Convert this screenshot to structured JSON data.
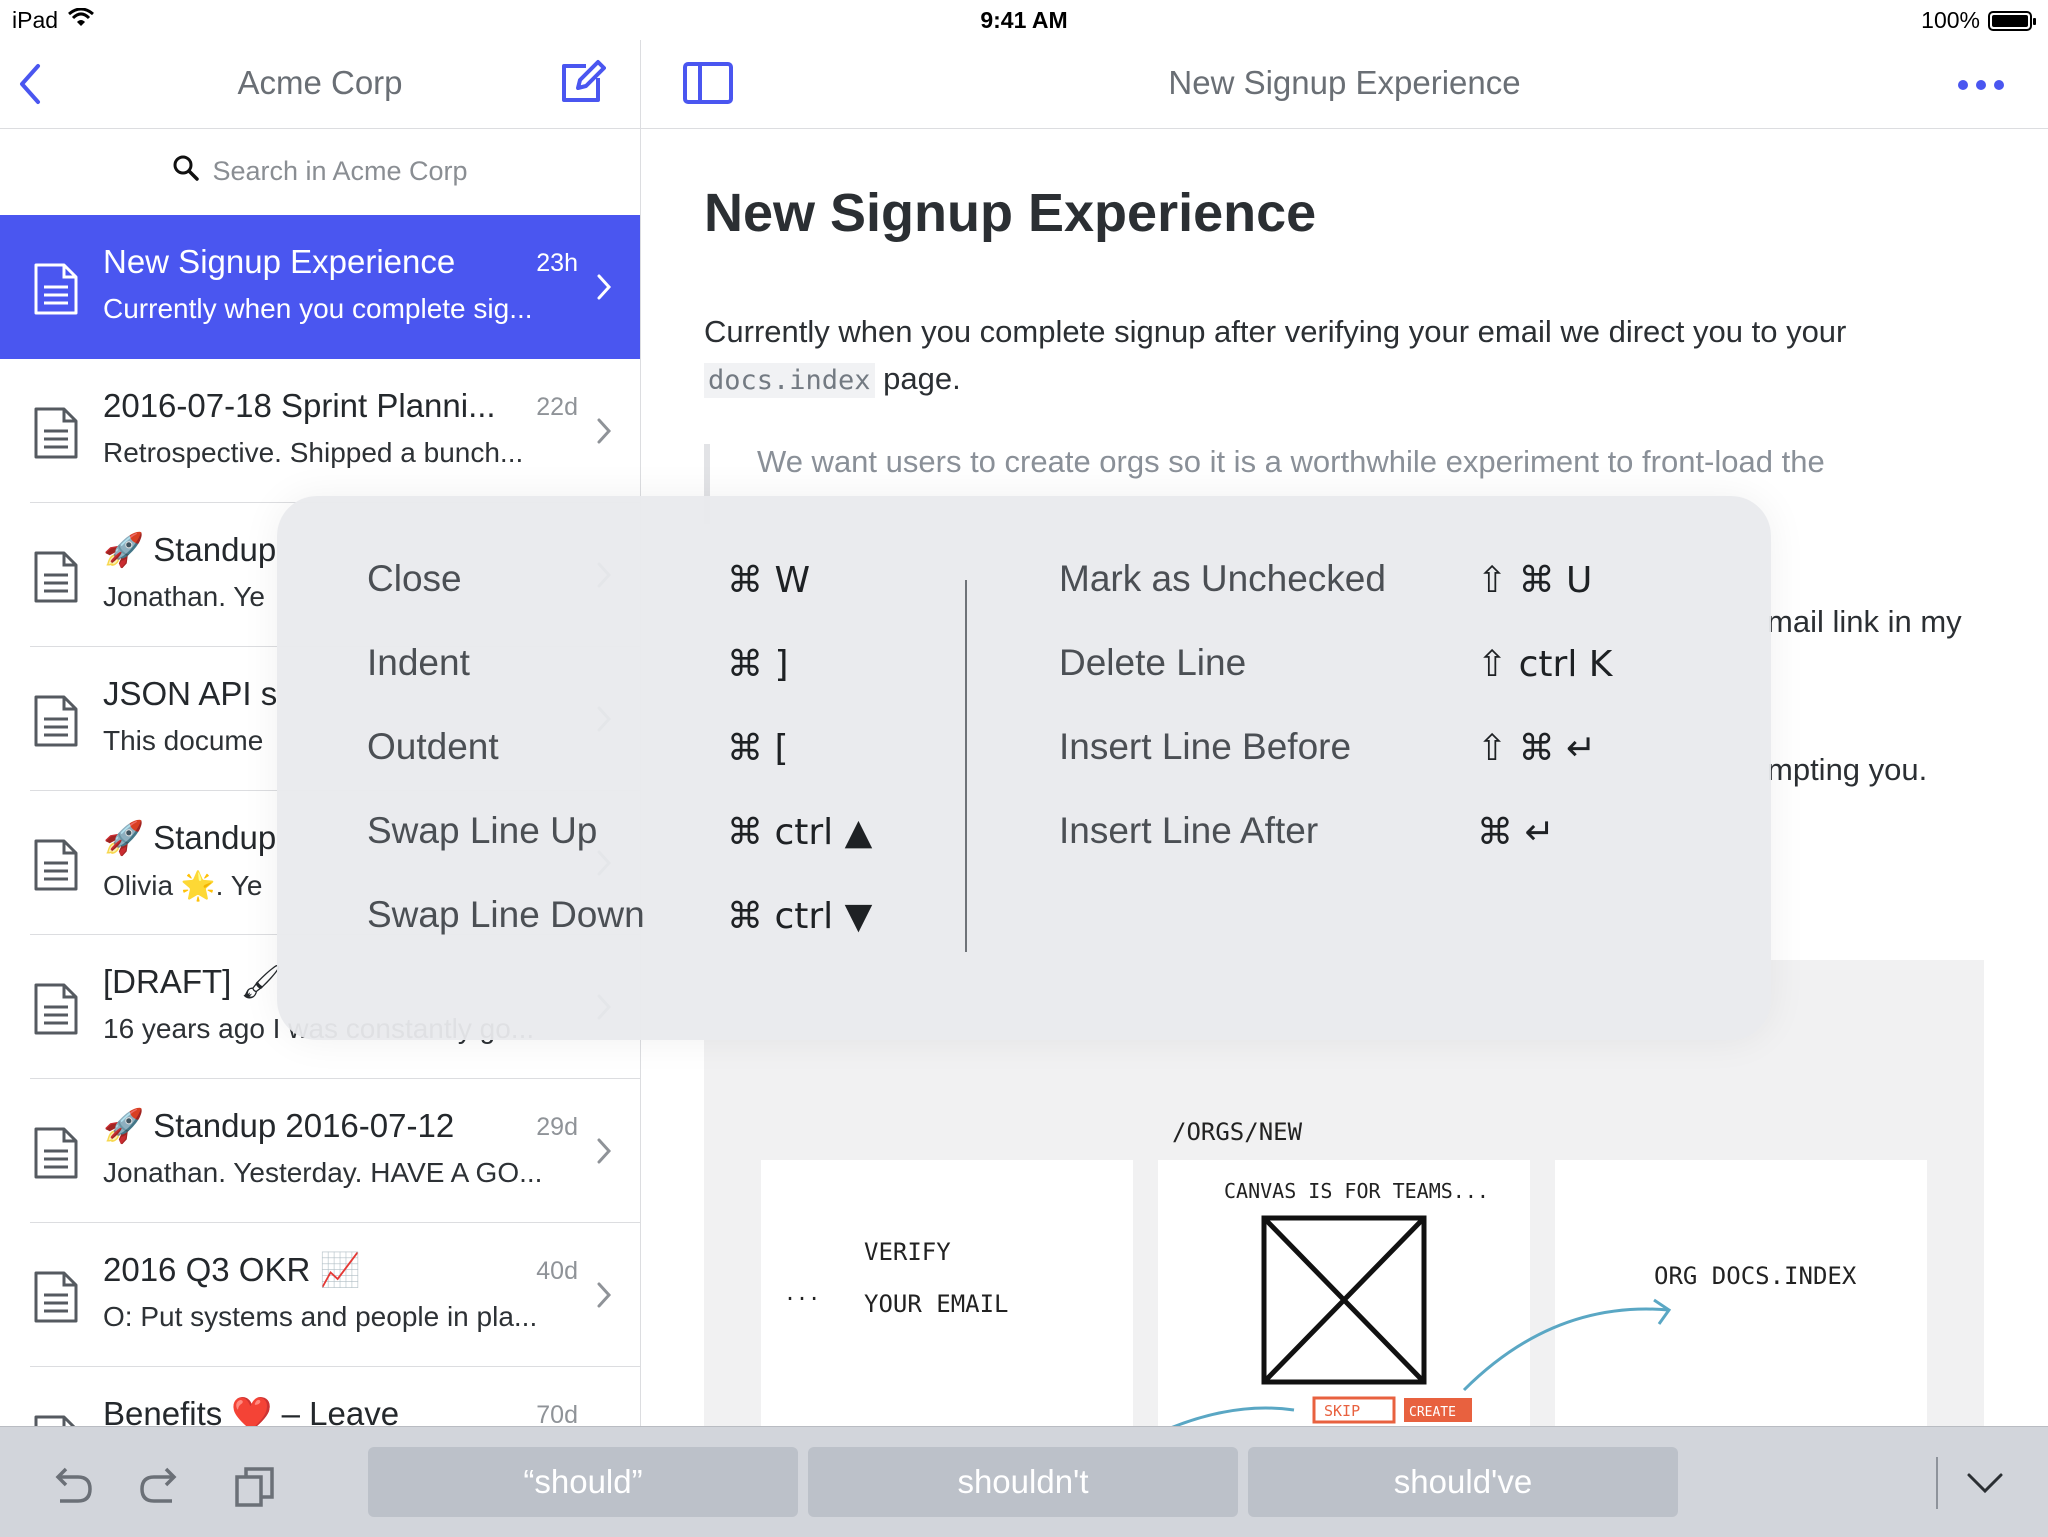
{
  "status_bar": {
    "device": "iPad",
    "time": "9:41 AM",
    "battery": "100%"
  },
  "left_pane": {
    "title": "Acme Corp",
    "search_placeholder": "Search in Acme Corp",
    "documents": [
      {
        "title": "New Signup Experience",
        "snippet": "Currently when you complete sig...",
        "age": "23h",
        "selected": true
      },
      {
        "title": "2016-07-18 Sprint Planni...",
        "snippet": "Retrospective. Shipped a bunch...",
        "age": "22d"
      },
      {
        "title": "🚀 Standup",
        "snippet": "Jonathan. Ye",
        "age": ""
      },
      {
        "title": "JSON API s",
        "snippet": "This docume",
        "age": ""
      },
      {
        "title": "🚀 Standup",
        "snippet": "Olivia 🌟. Ye",
        "age": ""
      },
      {
        "title": "[DRAFT] 🖌",
        "snippet": "16 years ago I was constantly go...",
        "age": ""
      },
      {
        "title": "🚀 Standup 2016-07-12",
        "snippet": "Jonathan. Yesterday. HAVE A GO...",
        "age": "29d"
      },
      {
        "title": "2016 Q3 OKR 📈",
        "snippet": "O: Put systems and people in pla...",
        "age": "40d"
      },
      {
        "title": "Benefits ❤️ – Leave",
        "snippet": "",
        "age": "70d"
      }
    ]
  },
  "right_pane": {
    "nav_title": "New Signup Experience",
    "heading": "New Signup Experience",
    "para_before_code": "Currently when you complete signup after verifying your email we direct you to your",
    "code": "docs.index",
    "para_after_code": " page.",
    "quote": "We want users to create orgs so it is a worthwhile experiment to front-load the",
    "partial_line_1": "mail link in my",
    "partial_line_2": "mpting you.",
    "sketch_labels": {
      "route": "/ORGS/NEW",
      "verify": "VERIFY",
      "your_email": "YOUR EMAIL",
      "ellipsis": "...",
      "canvas": "CANVAS IS FOR TEAMS...",
      "skip": "SKIP",
      "create": "CREATE",
      "org_docs": "ORG DOCS.INDEX"
    }
  },
  "shortcuts": {
    "left": [
      {
        "label": "Close",
        "keys": "⌘ W"
      },
      {
        "label": "Indent",
        "keys": "⌘ ]"
      },
      {
        "label": "Outdent",
        "keys": "⌘ ["
      },
      {
        "label": "Swap Line Up",
        "keys": "⌘ ctrl ▲"
      },
      {
        "label": "Swap Line Down",
        "keys": "⌘ ctrl ▼"
      }
    ],
    "right": [
      {
        "label": "Mark as Unchecked",
        "keys": "⇧ ⌘ U"
      },
      {
        "label": "Delete Line",
        "keys": "⇧ ctrl K"
      },
      {
        "label": "Insert Line Before",
        "keys": "⇧ ⌘ ↵"
      },
      {
        "label": "Insert Line After",
        "keys": "⌘ ↵"
      }
    ]
  },
  "keyboard_bar": {
    "suggestions": [
      "“should”",
      "shouldn't",
      "should've"
    ],
    "icons": [
      "undo-icon",
      "redo-icon",
      "paste-icon",
      "hide-keyboard-icon"
    ]
  },
  "colors": {
    "accent": "#4a56f0",
    "selected_row": "#4a56f0",
    "overlay": "#e9eaed",
    "keyboard_bar": "#d2d5db"
  }
}
